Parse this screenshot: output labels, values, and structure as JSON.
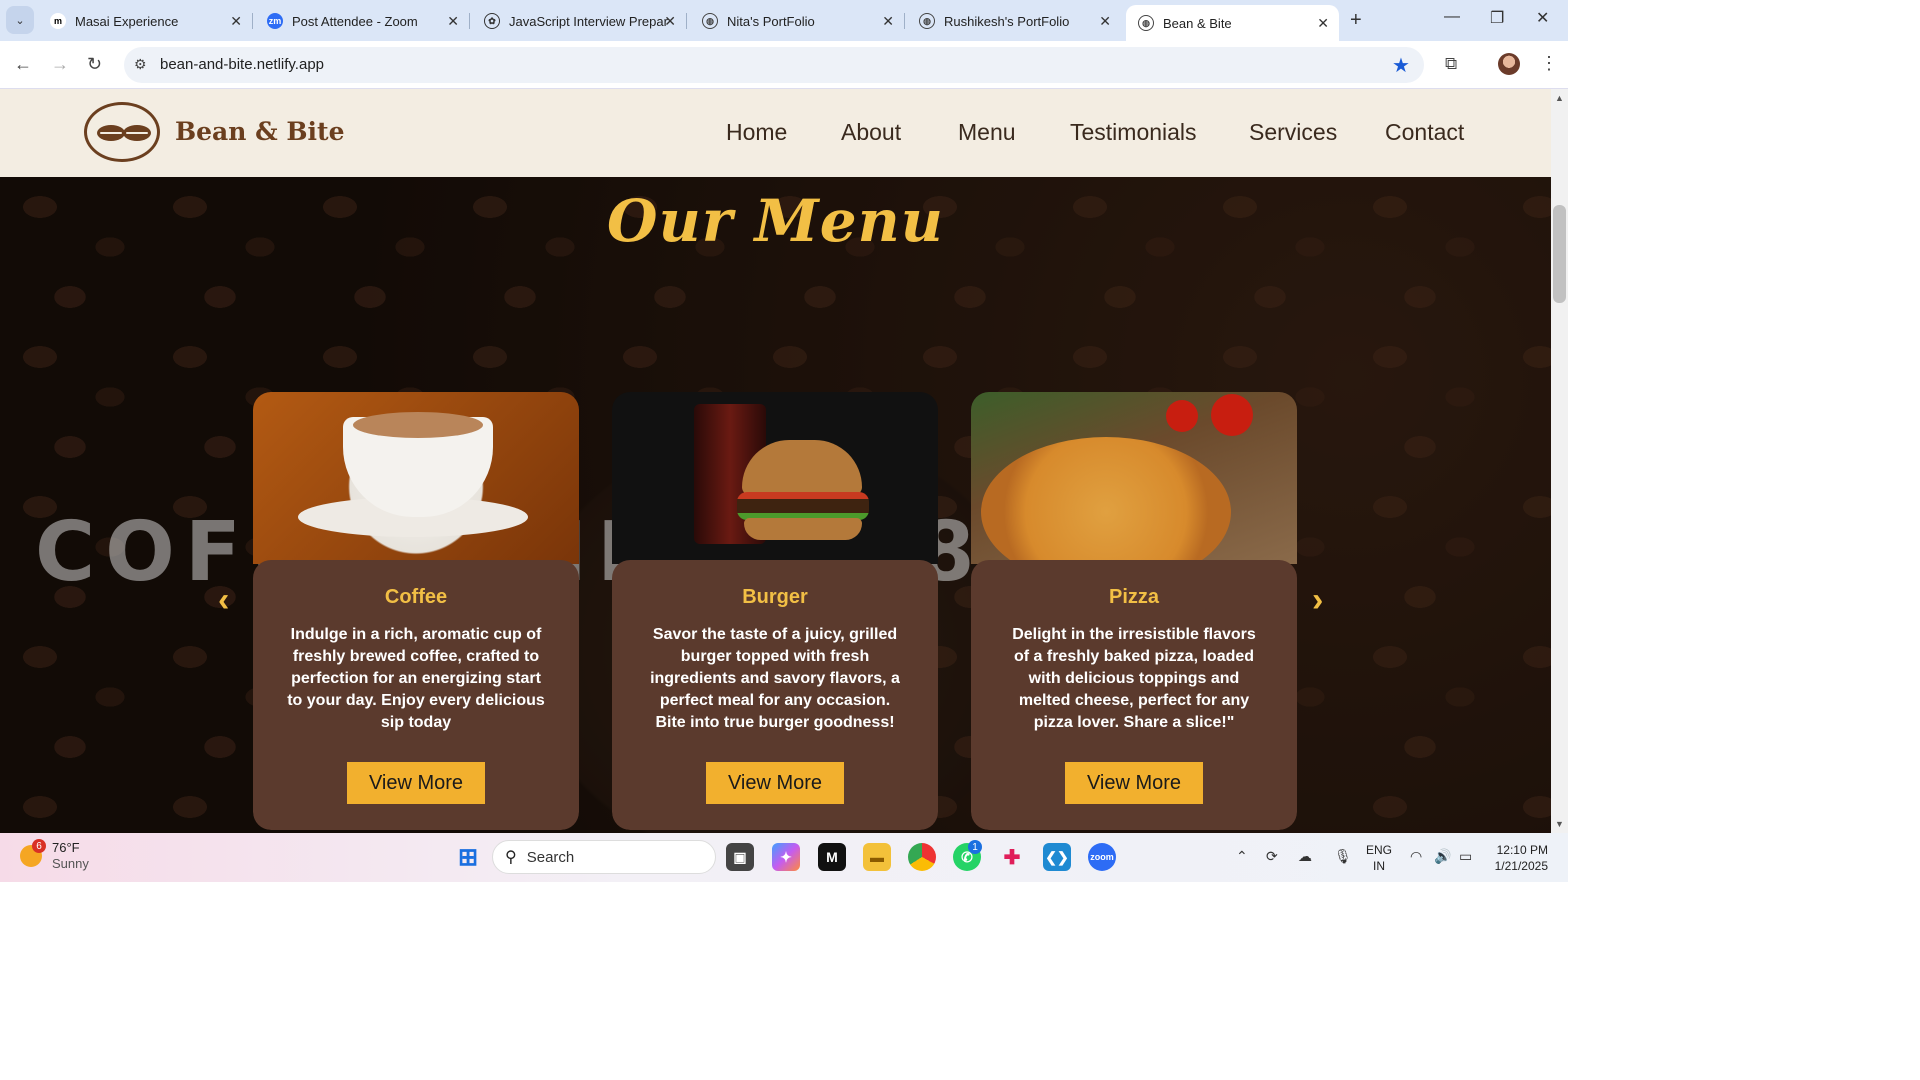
{
  "browser": {
    "tabs": [
      {
        "title": "Masai Experience",
        "favicon": "m"
      },
      {
        "title": "Post Attendee - Zoom",
        "favicon": "zm"
      },
      {
        "title": "JavaScript Interview Prepar",
        "favicon": "openai-icon"
      },
      {
        "title": "Nita's PortFolio",
        "favicon": "globe-icon"
      },
      {
        "title": "Rushikesh's PortFolio",
        "favicon": "globe-icon"
      },
      {
        "title": "Bean & Bite",
        "favicon": "globe-icon"
      }
    ],
    "url": "bean-and-bite.netlify.app"
  },
  "site": {
    "brand": "Bean & Bite",
    "nav": [
      "Home",
      "About",
      "Menu",
      "Testimonials",
      "Services",
      "Contact"
    ],
    "section_title": "Our Menu",
    "background_text": "COFFEE SINCE 1870",
    "cards": [
      {
        "title": "Coffee",
        "description": "Indulge in a rich, aromatic cup of freshly brewed coffee, crafted to perfection for an energizing start to your day. Enjoy every delicious sip today",
        "button": "View More"
      },
      {
        "title": "Burger",
        "description": "Savor the taste of a juicy, grilled burger topped with fresh ingredients and savory flavors, a perfect meal for any occasion. Bite into true burger goodness!",
        "button": "View More"
      },
      {
        "title": "Pizza",
        "description": "Delight in the irresistible flavors of a freshly baked pizza, loaded with delicious toppings and melted cheese, perfect for any pizza lover. Share a slice!\"",
        "button": "View More"
      }
    ],
    "colors": {
      "accent": "#f2bf45",
      "card_body": "#5b3a2d",
      "button": "#f2b02e",
      "header_bg": "#f3ede2"
    }
  },
  "taskbar": {
    "weather_temp": "76°F",
    "weather_desc": "Sunny",
    "weather_badge": "6",
    "search_placeholder": "Search",
    "whatsapp_badge": "1",
    "lang_top": "ENG",
    "lang_bottom": "IN",
    "time": "12:10 PM",
    "date": "1/21/2025"
  }
}
